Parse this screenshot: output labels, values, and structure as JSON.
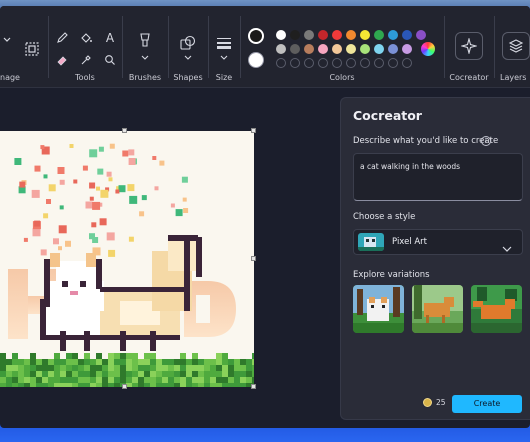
{
  "ribbon": {
    "groups": {
      "image": "nage",
      "tools": "Tools",
      "brushes": "Brushes",
      "shapes": "Shapes",
      "size": "Size",
      "colors": "Colors",
      "cocreator": "Cocreator",
      "layers": "Layers"
    },
    "palette_row1": [
      "#ffffff",
      "#1f1f1f",
      "#7a7a7a",
      "#c3262b",
      "#ef3a3a",
      "#f1892f",
      "#f5e634",
      "#2fa84f",
      "#2d9bd8",
      "#2a57b8",
      "#8a4fc6"
    ],
    "palette_row2": [
      "#bfbfbf",
      "#5e5e5e",
      "#b77d5d",
      "#f7a6c0",
      "#f3c89a",
      "#efe59a",
      "#a8e37a",
      "#7fd4ef",
      "#7b91d6",
      "#c79be3"
    ]
  },
  "panel": {
    "title": "Cocreator",
    "prompt_label": "Describe what you'd like to create",
    "prompt_value": "a cat walking in the woods",
    "style_label": "Choose a style",
    "style_value": "Pixel Art",
    "variations_label": "Explore variations",
    "credits": "25",
    "create_label": "Create"
  },
  "colors": {
    "accent": "#1fb8ff",
    "panel_bg": "#2a2c38",
    "app_bg": "#1b1e2c"
  }
}
